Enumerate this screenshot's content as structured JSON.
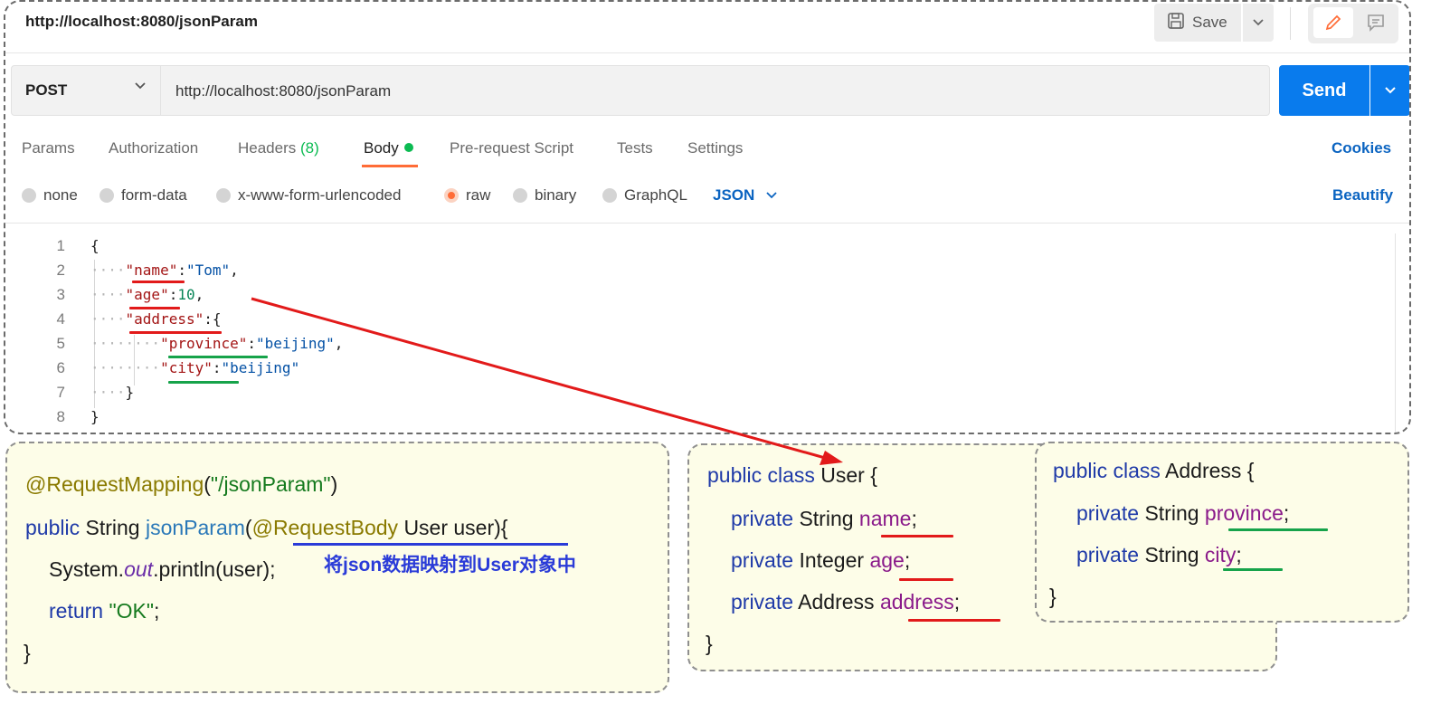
{
  "header": {
    "tab_title": "http://localhost:8080/jsonParam",
    "save_label": "Save"
  },
  "request": {
    "method": "POST",
    "url": "http://localhost:8080/jsonParam",
    "send_label": "Send"
  },
  "tabs": {
    "params": "Params",
    "authorization": "Authorization",
    "headers": "Headers",
    "headers_count": "(8)",
    "body": "Body",
    "prerequest": "Pre-request Script",
    "tests": "Tests",
    "settings": "Settings",
    "cookies": "Cookies"
  },
  "body_types": {
    "none": "none",
    "form_data": "form-data",
    "urlencoded": "x-www-form-urlencoded",
    "raw": "raw",
    "binary": "binary",
    "graphql": "GraphQL",
    "selected": "raw",
    "format": "JSON",
    "beautify": "Beautify"
  },
  "editor": {
    "line_numbers": [
      "1",
      "2",
      "3",
      "4",
      "5",
      "6",
      "7",
      "8"
    ],
    "l1": "{",
    "l2_key": "\"name\"",
    "l2_val": "\"Tom\"",
    "l3_key": "\"age\"",
    "l3_val": "10",
    "l4_key": "\"address\"",
    "l4_open": "{",
    "l5_key": "\"province\"",
    "l5_val": "\"beijing\"",
    "l6_key": "\"city\"",
    "l6_val": "\"beijing\"",
    "l7": "}",
    "l8": "}"
  },
  "controller": {
    "annotation": "@RequestMapping",
    "mapping_path": "\"/jsonParam\"",
    "public": "public",
    "return_type": "String",
    "method_name": "jsonParam",
    "param_annotation": "@RequestBody",
    "param": "User user",
    "system": "System.",
    "out": "out",
    "println": ".println(user);",
    "return_kw": "return",
    "return_val": "\"OK\"",
    "close": "}",
    "note": "将json数据映射到User对象中"
  },
  "user_class": {
    "decl_kw": "public class",
    "name": "User",
    "private_kw": "private",
    "fields": [
      {
        "type": "String",
        "name": "name"
      },
      {
        "type": "Integer",
        "name": "age"
      },
      {
        "type": "Address",
        "name": "address"
      }
    ],
    "close": "}"
  },
  "address_class": {
    "decl_kw": "public class",
    "name": "Address",
    "private_kw": "private",
    "fields": [
      {
        "type": "String",
        "name": "province"
      },
      {
        "type": "String",
        "name": "city"
      }
    ],
    "close": "}"
  },
  "colors": {
    "send": "#097bed",
    "active_tab": "#ff6c37",
    "body_dot": "#0cbb52",
    "json_key": "#a31515",
    "json_string": "#0451a5",
    "arrow": "#e21a1a"
  }
}
